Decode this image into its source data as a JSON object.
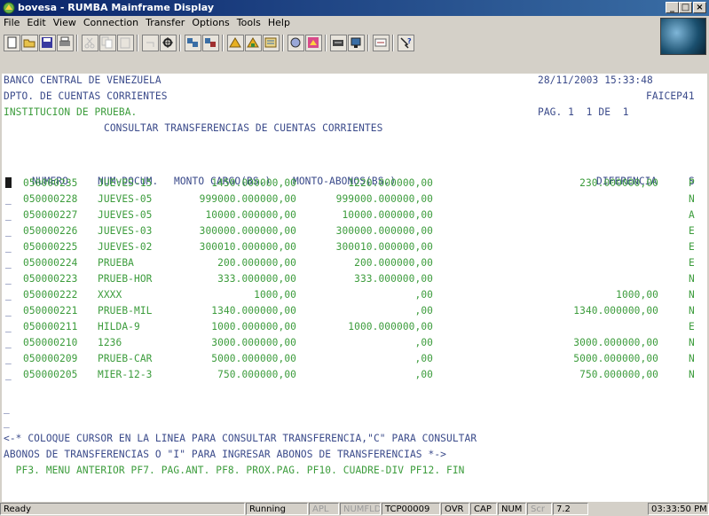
{
  "window": {
    "title": "bovesa - RUMBA Mainframe Display",
    "controls": [
      "_",
      "□",
      "×"
    ]
  },
  "menu": [
    "File",
    "Edit",
    "View",
    "Connection",
    "Transfer",
    "Options",
    "Tools",
    "Help"
  ],
  "toolbar": {
    "icons": [
      "new-icon",
      "open-icon",
      "save-icon",
      "print-icon",
      "cut-icon",
      "copy-icon",
      "paste-icon",
      "undo-icon",
      "settings-icon",
      "connect-icon",
      "disconnect-icon",
      "send-icon",
      "receive-icon",
      "transfer-icon",
      "macro-icon",
      "record-icon",
      "keyboard-icon",
      "display-icon",
      "key-icon",
      "help-icon"
    ]
  },
  "header": {
    "line1_left": "BANCO CENTRAL DE VENEZUELA",
    "line1_right": "28/11/2003 15:33:48",
    "line2_left": "DPTO. DE CUENTAS CORRIENTES",
    "line2_right": "FAICEP41",
    "line3_left": "INSTITUCION DE PRUEBA.",
    "line3_right": "PAG. 1  1 DE  1",
    "title": "CONSULTAR TRANSFERENCIAS DE CUENTAS CORRIENTES"
  },
  "table": {
    "headers": [
      "NUMERO",
      "NUM-DOCUM.",
      "MONTO CARGO(BS.)",
      "MONTO-ABONOS(BS.)",
      "DIFERENCIA",
      "S"
    ],
    "rows": [
      [
        "050000235",
        "JUEVES-15",
        "1450.000000,00",
        "1220.000000,00",
        "230.000000,00",
        "P"
      ],
      [
        "050000228",
        "JUEVES-05",
        "999000.000000,00",
        "999000.000000,00",
        "",
        "N"
      ],
      [
        "050000227",
        "JUEVES-05",
        "10000.000000,00",
        "10000.000000,00",
        "",
        "A"
      ],
      [
        "050000226",
        "JUEVES-03",
        "300000.000000,00",
        "300000.000000,00",
        "",
        "E"
      ],
      [
        "050000225",
        "JUEVES-02",
        "300010.000000,00",
        "300010.000000,00",
        "",
        "E"
      ],
      [
        "050000224",
        "PRUEBA",
        "200.000000,00",
        "200.000000,00",
        "",
        "E"
      ],
      [
        "050000223",
        "PRUEB-HOR",
        "333.000000,00",
        "333.000000,00",
        "",
        "N"
      ],
      [
        "050000222",
        "XXXX",
        "1000,00",
        ",00",
        "1000,00",
        "N"
      ],
      [
        "050000221",
        "PRUEB-MIL",
        "1340.000000,00",
        ",00",
        "1340.000000,00",
        "N"
      ],
      [
        "050000211",
        "HILDA-9",
        "1000.000000,00",
        "1000.000000,00",
        "",
        "E"
      ],
      [
        "050000210",
        "1236",
        "3000.000000,00",
        ",00",
        "3000.000000,00",
        "N"
      ],
      [
        "050000209",
        "PRUEB-CAR",
        "5000.000000,00",
        ",00",
        "5000.000000,00",
        "N"
      ],
      [
        "050000205",
        "MIER-12-3",
        "750.000000,00",
        ",00",
        "750.000000,00",
        "N"
      ]
    ]
  },
  "footer": {
    "line1": "<-* COLOQUE CURSOR EN LA LINEA PARA CONSULTAR TRANSFERENCIA,\"C\" PARA CONSULTAR",
    "line2": "ABONOS DE TRANSFERENCIAS O \"I\" PARA INGRESAR ABONOS DE TRANSFERENCIAS *->",
    "line3": "  PF3. MENU ANTERIOR PF7. PAG.ANT. PF8. PROX.PAG. PF10. CUADRE-DIV PF12. FIN"
  },
  "status": {
    "ready": "Ready",
    "running": "Running",
    "apl": "APL",
    "numfld": "NUMFLD",
    "session": "TCP00009",
    "ovr": "OVR",
    "cap": "CAP",
    "num": "NUM",
    "scr": "Scr",
    "pos": "7.2",
    "time": "03:33:50 PM"
  },
  "colors": {
    "header_text": "#3a4a8a",
    "data_text": "#3c9c3c",
    "title_bar": "#0a246a"
  }
}
